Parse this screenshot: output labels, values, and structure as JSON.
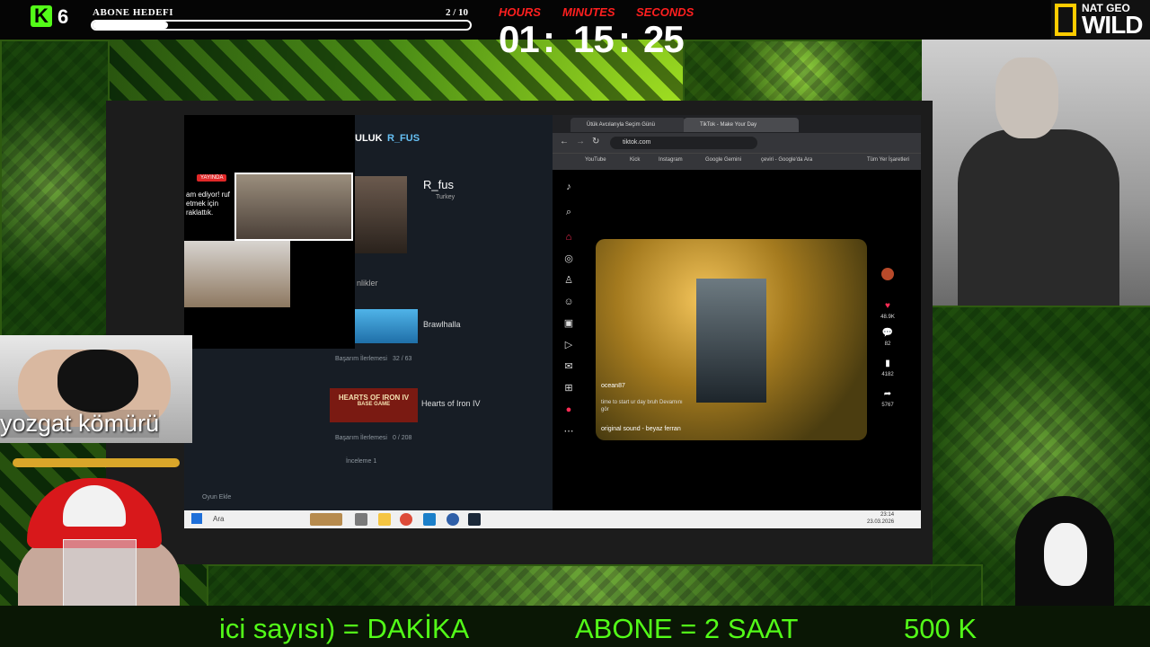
{
  "top_bar": {
    "kick_letter": "K",
    "kick_count": "6",
    "goal_label": "ABONE HEDEFI",
    "goal_count": "2 / 10",
    "goal_progress": 0.2
  },
  "timer": {
    "hours_label": "HOURS",
    "minutes_label": "MINUTES",
    "seconds_label": "SECONDS",
    "hours": "01",
    "minutes": "15",
    "seconds": "25",
    "sep": ":"
  },
  "logo": {
    "top": "NAT GEO",
    "bottom": "WILD"
  },
  "steam": {
    "nav_left": "ULUK",
    "nav_user": "R_FUS",
    "profile_name": "R_fus",
    "profile_country": "Turkey",
    "section": "nlikler",
    "games": [
      {
        "name": "Brawlhalla",
        "progress_label": "Başarım İlerlemesi",
        "progress": "32 / 63"
      },
      {
        "name": "Hearts of Iron IV",
        "progress_label": "Başarım İlerlemesi",
        "progress": "0 / 208"
      }
    ],
    "thumb_hoi": "HEARTS OF IRON IV",
    "thumb_hoi_sub": "BASE GAME",
    "inceleme": "İnceleme 1",
    "footer": "Oyun Ekle"
  },
  "stream_overlay": {
    "live_badge": "YAYINDA",
    "live_text": "am ediyor! ruf etmek için raklattık."
  },
  "browser": {
    "tabs": [
      "Ütük Avcılarıyla Seçim Günü",
      "TikTok - Make Your Day"
    ],
    "url": "tiktok.com",
    "bookmarks": [
      "YouTube",
      "Kick",
      "Instagram",
      "Google Gemini",
      "çeviri - Google'da Ara",
      "Tüm Yer İşaretleri"
    ],
    "video": {
      "user": "ocean87",
      "caption": "time to start ur day bruh Devamını gör",
      "sound": "original sound - beyaz ferran"
    },
    "actions": [
      {
        "icon": "heart-icon",
        "count": "48.9K"
      },
      {
        "icon": "comment-icon",
        "count": "82"
      },
      {
        "icon": "bookmark-icon",
        "count": "4182"
      },
      {
        "icon": "share-icon",
        "count": "5767"
      }
    ]
  },
  "taskbar": {
    "search": "Ara",
    "time": "23:14",
    "date": "23.03.2026"
  },
  "coal": {
    "label": "yozgat kömürü"
  },
  "ticker": {
    "segments": [
      "ici sayısı) = DAKİKA",
      "ABONE = 2 SAAT",
      "500 K"
    ]
  }
}
